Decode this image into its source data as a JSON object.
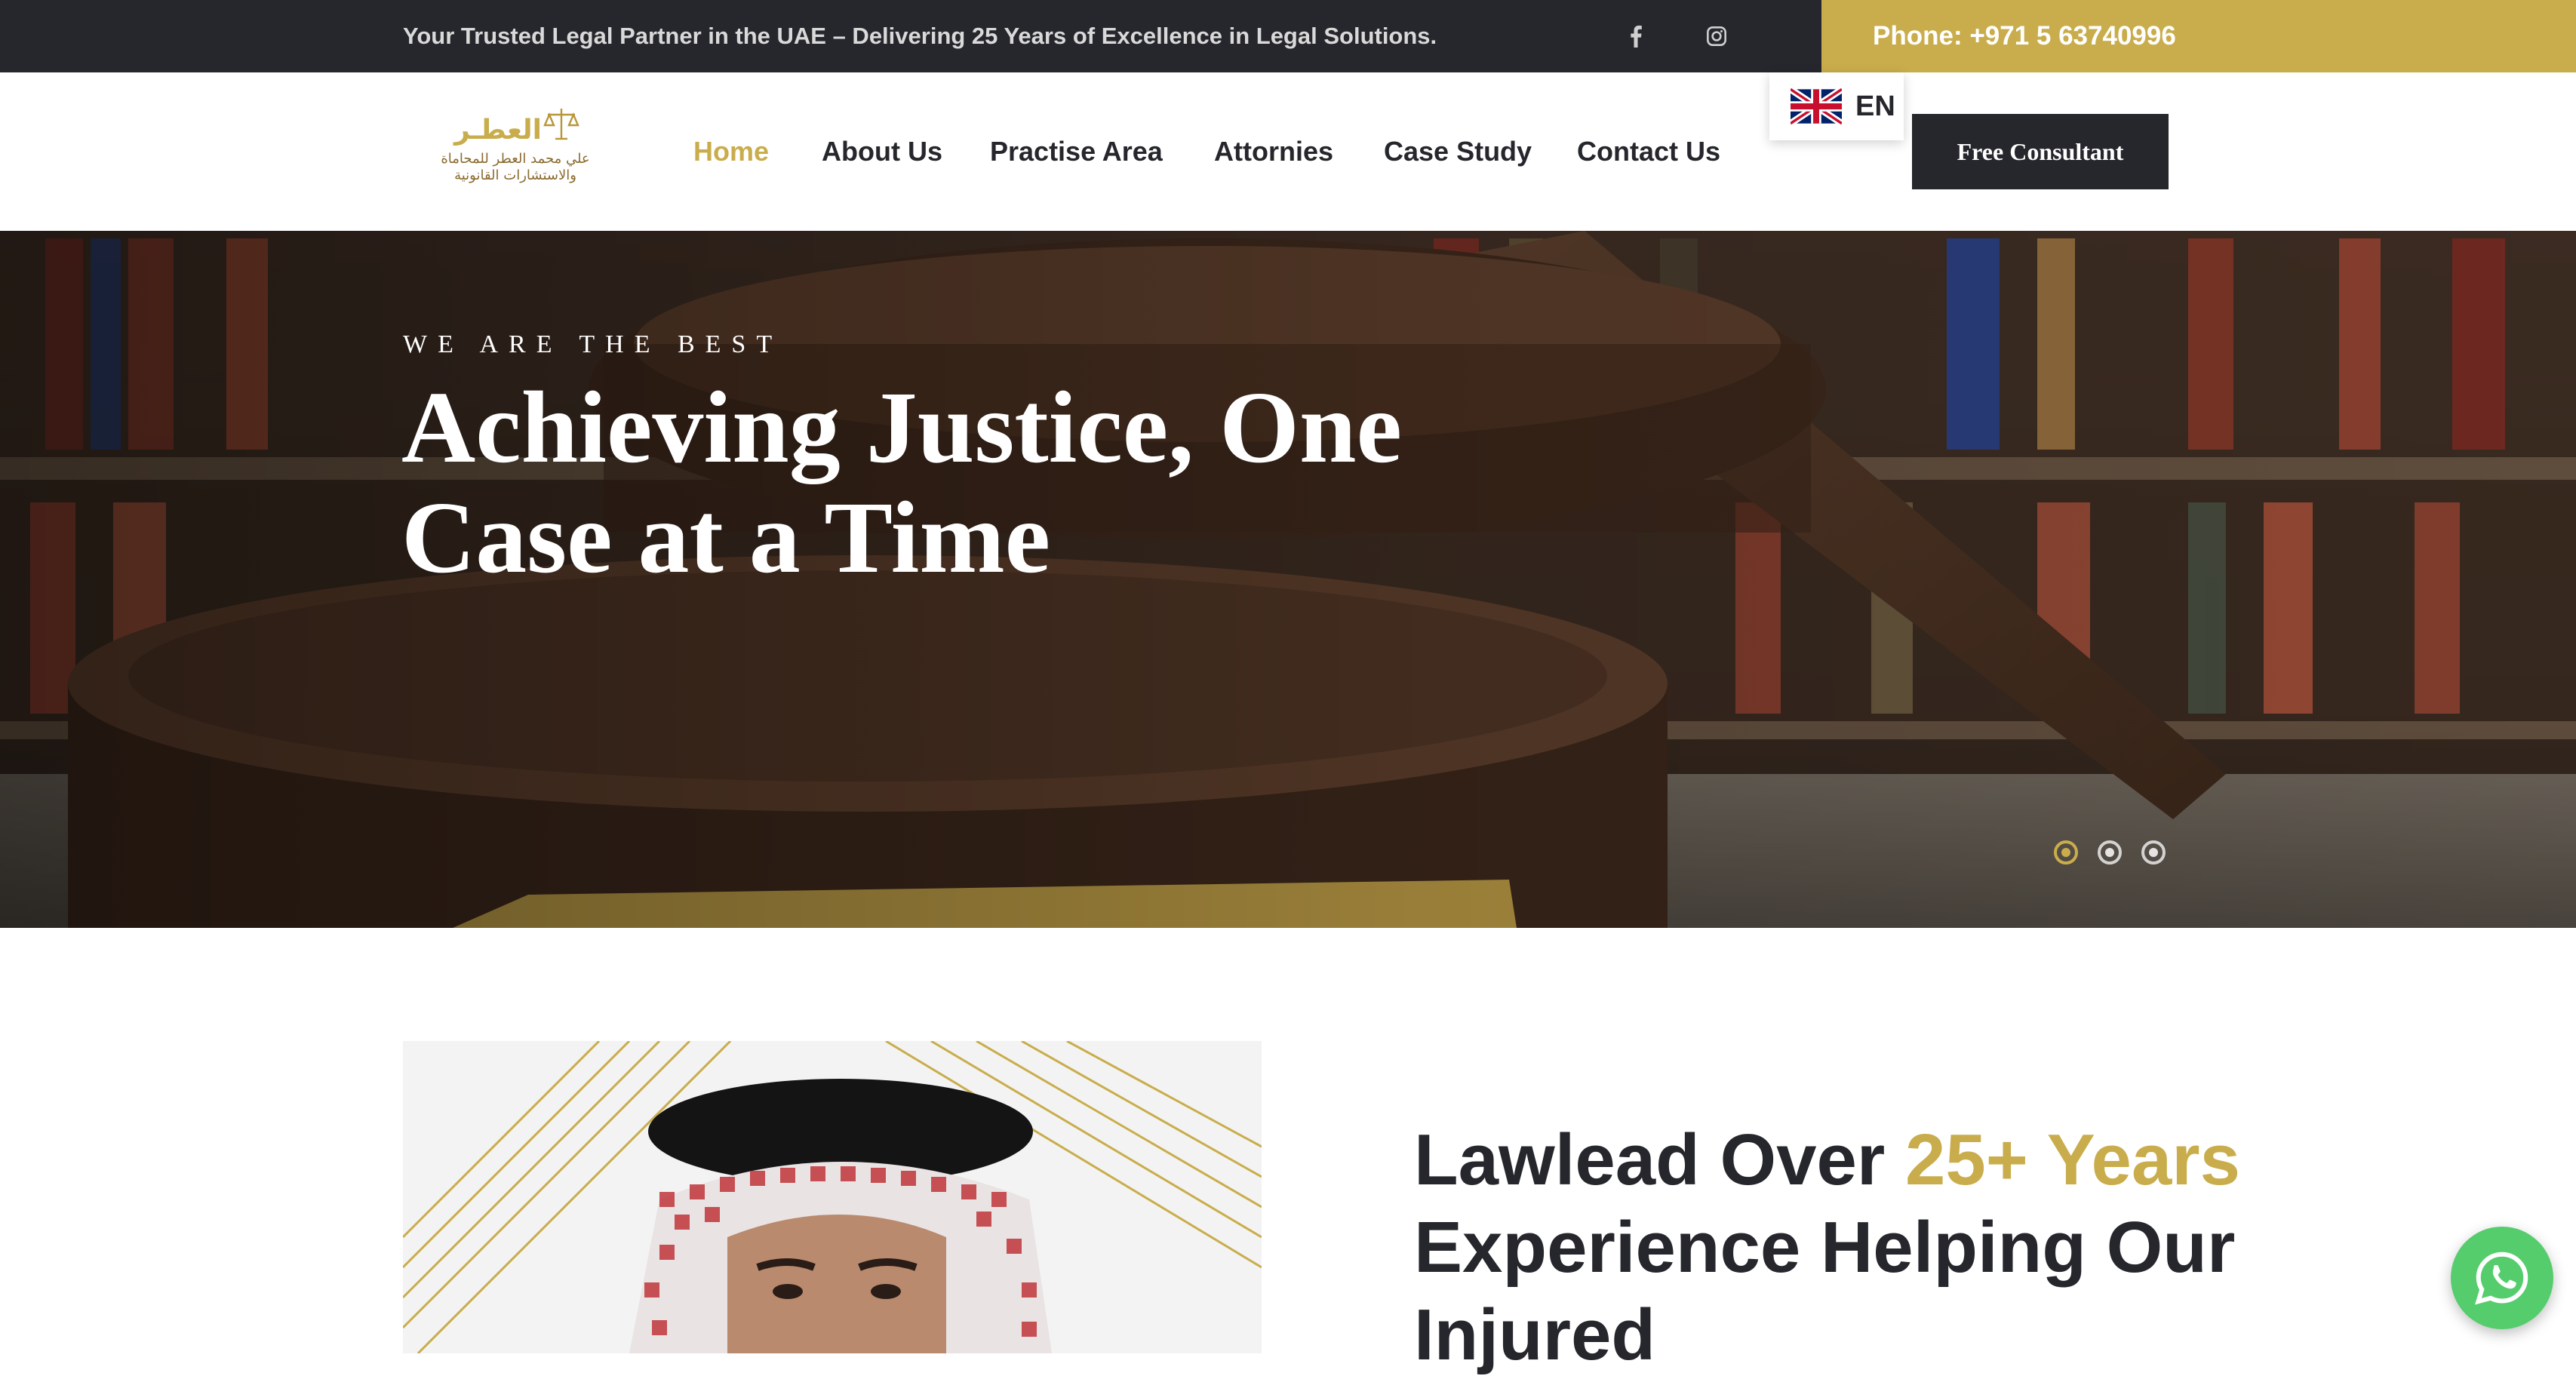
{
  "topbar": {
    "tagline": "Your Trusted Legal Partner in the UAE – Delivering 25 Years of Excellence in Legal Solutions.",
    "phone": "Phone: +971 5 63740996",
    "social": [
      "facebook-icon",
      "instagram-icon"
    ]
  },
  "brand": {
    "logo_text_ar_line1": "علي محمد العطر للمحاماة",
    "logo_text_ar_line2": "والاستشارات القانونية",
    "logo_mark_ar": "العطـر",
    "gold": "#c9ad4c",
    "dark": "#25272c"
  },
  "nav": {
    "items": [
      {
        "label": "Home",
        "active": true
      },
      {
        "label": "About Us"
      },
      {
        "label": "Practise Area"
      },
      {
        "label": "Attornies"
      },
      {
        "label": "Case Study"
      },
      {
        "label": "Contact Us"
      }
    ],
    "language": "EN",
    "cta": "Free Consultant"
  },
  "hero": {
    "kicker": "WE ARE THE BEST",
    "headline_line1": "Achieving Justice, One",
    "headline_line2": "Case at a Time",
    "slides": 3,
    "active_slide": 1
  },
  "about": {
    "heading_part1": "Lawlead Over ",
    "heading_gold": "25+ Years",
    "heading_part2": " Experience Helping Our Injured"
  },
  "whatsapp": {
    "icon": "whatsapp-icon"
  }
}
